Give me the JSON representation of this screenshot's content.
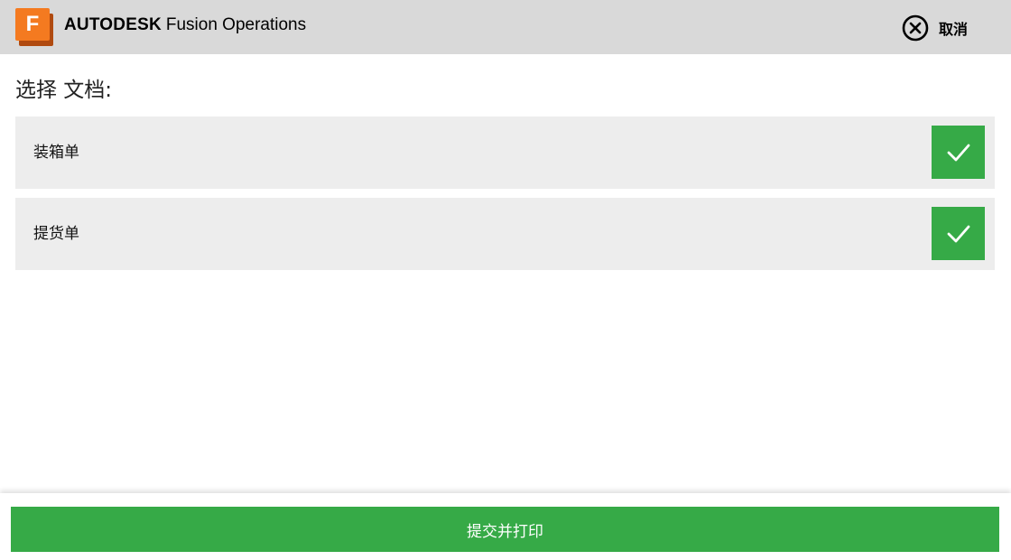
{
  "header": {
    "logo_letter": "F",
    "logo_icon": "autodesk-fusion-logo-icon",
    "brand_strong": "AUTODESK",
    "brand_rest": "Fusion Operations",
    "cancel_icon": "close-circle-icon",
    "cancel_label": "取消"
  },
  "main": {
    "title": "选择 文档:",
    "documents": [
      {
        "label": "装箱单",
        "checked": true,
        "check_icon": "checkmark-icon"
      },
      {
        "label": "提货单",
        "checked": true,
        "check_icon": "checkmark-icon"
      }
    ]
  },
  "footer": {
    "submit_label": "提交并打印"
  },
  "colors": {
    "header_bg": "#d9d9d9",
    "accent_green": "#36aa47",
    "logo_orange": "#f47a20",
    "row_bg": "#ededed"
  }
}
